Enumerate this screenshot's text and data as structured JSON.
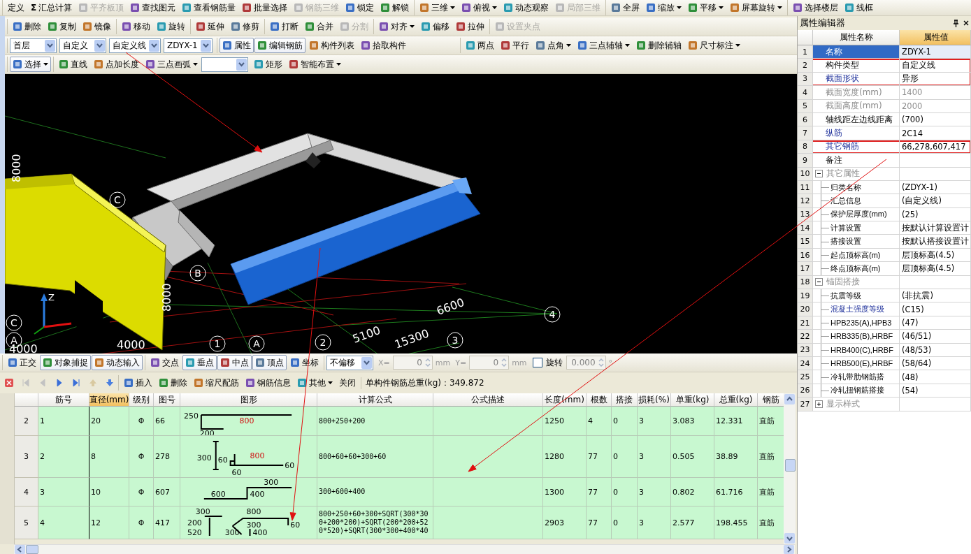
{
  "main_toolbar": {
    "groups": [
      {
        "items": [
          {
            "kind": "button",
            "label": "定义",
            "icon": false,
            "disabled": false,
            "menu": false
          },
          {
            "kind": "button",
            "glyph": "Σ",
            "label": "汇总计算",
            "icon": false,
            "disabled": false,
            "menu": false
          },
          {
            "kind": "button",
            "label": "平齐板顶",
            "icon": true,
            "disabled": true,
            "menu": false
          },
          {
            "kind": "button",
            "label": "查找图元",
            "icon": true,
            "disabled": false,
            "menu": false
          },
          {
            "kind": "button",
            "label": "查看钢筋量",
            "icon": true,
            "disabled": false,
            "menu": false
          },
          {
            "kind": "button",
            "label": "批量选择",
            "icon": true,
            "disabled": false,
            "menu": false
          },
          {
            "kind": "button",
            "label": "钢筋三维",
            "icon": true,
            "disabled": true,
            "menu": false
          },
          {
            "kind": "button",
            "label": "锁定",
            "icon": true,
            "disabled": false,
            "menu": false
          },
          {
            "kind": "button",
            "label": "解锁",
            "icon": true,
            "disabled": false,
            "menu": false
          }
        ]
      },
      {
        "items": [
          {
            "kind": "button",
            "label": "三维",
            "icon": true,
            "disabled": false,
            "menu": true
          },
          {
            "kind": "button",
            "label": "俯视",
            "icon": true,
            "disabled": false,
            "menu": true
          },
          {
            "kind": "button",
            "label": "动态观察",
            "icon": true,
            "disabled": false,
            "menu": false
          },
          {
            "kind": "button",
            "label": "局部三维",
            "icon": true,
            "disabled": true,
            "menu": false
          }
        ]
      },
      {
        "items": [
          {
            "kind": "button",
            "label": "全屏",
            "icon": true,
            "disabled": false,
            "menu": false
          },
          {
            "kind": "button",
            "label": "缩放",
            "icon": true,
            "disabled": false,
            "menu": true
          },
          {
            "kind": "button",
            "label": "平移",
            "icon": true,
            "disabled": false,
            "menu": true
          },
          {
            "kind": "button",
            "label": "屏幕旋转",
            "icon": true,
            "disabled": false,
            "menu": true
          }
        ]
      },
      {
        "items": [
          {
            "kind": "button",
            "label": "选择楼层",
            "icon": true,
            "disabled": false,
            "menu": false
          },
          {
            "kind": "button",
            "label": "线框",
            "icon": true,
            "disabled": false,
            "menu": false
          }
        ]
      }
    ]
  },
  "edit_toolbar": {
    "groups": [
      {
        "items": [
          {
            "kind": "button",
            "label": "删除",
            "icon": true,
            "disabled": false,
            "menu": false
          },
          {
            "kind": "button",
            "label": "复制",
            "icon": true,
            "disabled": false,
            "menu": false
          },
          {
            "kind": "button",
            "label": "镜像",
            "icon": true,
            "disabled": false,
            "menu": false
          }
        ]
      },
      {
        "items": [
          {
            "kind": "button",
            "label": "移动",
            "icon": true,
            "disabled": false,
            "menu": false
          },
          {
            "kind": "button",
            "label": "旋转",
            "icon": true,
            "disabled": false,
            "menu": false
          }
        ]
      },
      {
        "items": [
          {
            "kind": "button",
            "label": "延伸",
            "icon": true,
            "disabled": false,
            "menu": false
          },
          {
            "kind": "button",
            "label": "修剪",
            "icon": true,
            "disabled": false,
            "menu": false
          }
        ]
      },
      {
        "items": [
          {
            "kind": "button",
            "label": "打断",
            "icon": true,
            "disabled": false,
            "menu": false
          },
          {
            "kind": "button",
            "label": "合并",
            "icon": true,
            "disabled": false,
            "menu": false
          },
          {
            "kind": "button",
            "label": "分割",
            "icon": true,
            "disabled": true,
            "menu": false
          }
        ]
      },
      {
        "items": [
          {
            "kind": "button",
            "label": "对齐",
            "icon": true,
            "disabled": false,
            "menu": true
          },
          {
            "kind": "button",
            "label": "偏移",
            "icon": true,
            "disabled": false,
            "menu": false
          },
          {
            "kind": "button",
            "label": "拉伸",
            "icon": true,
            "disabled": false,
            "menu": false
          }
        ]
      },
      {
        "items": [
          {
            "kind": "button",
            "label": "设置夹点",
            "icon": true,
            "disabled": true,
            "menu": false
          }
        ]
      }
    ]
  },
  "component_toolbar": {
    "groups": [
      {
        "items": [
          {
            "kind": "dropdown",
            "value": "首层",
            "disabled": false
          },
          {
            "kind": "dropdown",
            "value": "自定义",
            "disabled": false
          },
          {
            "kind": "dropdown",
            "value": "自定义线",
            "disabled": false
          },
          {
            "kind": "dropdown",
            "value": "ZDYX-1",
            "disabled": false
          }
        ]
      },
      {
        "items": [
          {
            "kind": "button",
            "label": "属性",
            "icon": true,
            "disabled": false,
            "menu": false,
            "pressed": true
          },
          {
            "kind": "button",
            "label": "编辑钢筋",
            "icon": true,
            "disabled": false,
            "menu": false,
            "pressed": true
          },
          {
            "kind": "button",
            "label": "构件列表",
            "icon": true,
            "disabled": false,
            "menu": false,
            "pressed": false
          },
          {
            "kind": "button",
            "label": "拾取构件",
            "icon": true,
            "disabled": false,
            "menu": false,
            "pressed": false
          }
        ]
      },
      {
        "items": [
          {
            "kind": "button",
            "label": "两点",
            "icon": true,
            "disabled": false,
            "menu": false,
            "pressed": false
          },
          {
            "kind": "button",
            "label": "平行",
            "icon": true,
            "disabled": false,
            "menu": false,
            "pressed": false
          },
          {
            "kind": "button",
            "label": "点角",
            "icon": true,
            "disabled": false,
            "menu": true,
            "pressed": false
          },
          {
            "kind": "button",
            "label": "三点辅轴",
            "icon": true,
            "disabled": false,
            "menu": true,
            "pressed": false
          },
          {
            "kind": "button",
            "label": "删除辅轴",
            "icon": true,
            "disabled": false,
            "menu": false,
            "pressed": false
          },
          {
            "kind": "button",
            "label": "尺寸标注",
            "icon": true,
            "disabled": false,
            "menu": true,
            "pressed": false
          }
        ]
      }
    ]
  },
  "draw_toolbar": {
    "groups": [
      {
        "items": [
          {
            "kind": "button",
            "label": "选择",
            "icon": true,
            "disabled": false,
            "menu": true,
            "pressed": true
          }
        ]
      },
      {
        "items": [
          {
            "kind": "button",
            "label": "直线",
            "icon": true,
            "disabled": false,
            "menu": false,
            "pressed": false
          },
          {
            "kind": "button",
            "label": "点加长度",
            "icon": true,
            "disabled": false,
            "menu": false,
            "pressed": false
          },
          {
            "kind": "button",
            "label": "三点画弧",
            "icon": true,
            "disabled": false,
            "menu": true,
            "pressed": false
          },
          {
            "kind": "dropdown",
            "disabled": false
          },
          {
            "kind": "button",
            "label": "矩形",
            "icon": true,
            "disabled": false,
            "menu": false,
            "pressed": false
          },
          {
            "kind": "button",
            "label": "智能布置",
            "icon": true,
            "disabled": false,
            "menu": true,
            "pressed": false
          }
        ]
      }
    ]
  },
  "viewport": {
    "dimension_labels": [
      "8000",
      "8000",
      "4000",
      "4000",
      "5100",
      "6600",
      "15300"
    ],
    "axis_markers": [
      "C",
      "B",
      "4",
      "C",
      "A",
      "1",
      "A",
      "2",
      "3"
    ],
    "gizmo_label": "Z"
  },
  "snap_toolbar": {
    "groups": [
      {
        "items": [
          {
            "kind": "button",
            "label": "正交",
            "icon": true,
            "disabled": false,
            "menu": false,
            "pressed": false
          },
          {
            "kind": "button",
            "label": "对象捕捉",
            "icon": true,
            "disabled": false,
            "menu": false,
            "pressed": true
          },
          {
            "kind": "button",
            "label": "动态输入",
            "icon": true,
            "disabled": false,
            "menu": false,
            "pressed": true
          }
        ]
      },
      {
        "items": [
          {
            "kind": "button",
            "label": "交点",
            "icon": true,
            "disabled": false,
            "menu": false,
            "pressed": false
          },
          {
            "kind": "button",
            "label": "垂点",
            "icon": true,
            "disabled": false,
            "menu": false,
            "pressed": true
          },
          {
            "kind": "button",
            "label": "中点",
            "icon": true,
            "disabled": false,
            "menu": false,
            "pressed": true
          },
          {
            "kind": "button",
            "label": "顶点",
            "icon": true,
            "disabled": false,
            "menu": false,
            "pressed": true
          },
          {
            "kind": "button",
            "label": "坐标",
            "icon": true,
            "disabled": false,
            "menu": false,
            "pressed": false
          }
        ]
      },
      {
        "items": [
          {
            "kind": "dropdown",
            "value": "不偏移",
            "disabled": false
          },
          {
            "kind": "label",
            "text": "X="
          },
          {
            "kind": "spin",
            "value": "0",
            "disabled": true
          },
          {
            "kind": "label",
            "text": "mm"
          },
          {
            "kind": "label",
            "text": "Y="
          },
          {
            "kind": "spin",
            "value": "0",
            "disabled": true
          },
          {
            "kind": "label",
            "text": "mm"
          },
          {
            "kind": "checkbox",
            "label": "旋转",
            "checked": false
          },
          {
            "kind": "spin",
            "value": "0.000",
            "disabled": true
          },
          {
            "kind": "label",
            "text": "°"
          }
        ]
      }
    ]
  },
  "rebar_toolbar": {
    "navigation": [
      {
        "disabled": true
      },
      {
        "disabled": true
      },
      {
        "disabled": false
      },
      {
        "disabled": false
      }
    ],
    "move": [
      {
        "disabled": true
      },
      {
        "disabled": false
      }
    ],
    "groups": [
      {
        "items": [
          {
            "kind": "button",
            "label": "插入",
            "icon": true,
            "disabled": false,
            "menu": false
          },
          {
            "kind": "button",
            "label": "删除",
            "icon": true,
            "disabled": false,
            "menu": false
          },
          {
            "kind": "button",
            "label": "缩尺配筋",
            "icon": true,
            "disabled": false,
            "menu": false
          },
          {
            "kind": "button",
            "label": "钢筋信息",
            "icon": true,
            "disabled": false,
            "menu": false
          },
          {
            "kind": "button",
            "label": "其他",
            "icon": true,
            "disabled": false,
            "menu": true
          },
          {
            "kind": "button",
            "label": "关闭",
            "icon": false,
            "disabled": false,
            "menu": false
          }
        ]
      },
      {
        "items": [
          {
            "kind": "label",
            "text": "单构件钢筋总重(kg)：349.872"
          }
        ]
      }
    ]
  },
  "rebar_table": {
    "columns": [
      {
        "label": "筋号",
        "selected": false
      },
      {
        "label": "直径(mm)",
        "selected": true
      },
      {
        "label": "级别",
        "selected": false
      },
      {
        "label": "图号",
        "selected": false
      },
      {
        "label": "图形",
        "selected": false
      },
      {
        "label": "计算公式",
        "selected": false
      },
      {
        "label": "公式描述",
        "selected": false
      },
      {
        "label": "长度(mm)",
        "selected": false
      },
      {
        "label": "根数",
        "selected": false
      },
      {
        "label": "搭接",
        "selected": false
      },
      {
        "label": "损耗(%)",
        "selected": false
      },
      {
        "label": "单重(kg)",
        "selected": false
      },
      {
        "label": "总重(kg)",
        "selected": false
      },
      {
        "label": "钢筋",
        "selected": false
      }
    ],
    "rows": [
      {
        "row_number": "2",
        "bar_no": "1",
        "diameter": "20",
        "grade": "Φ",
        "figure_no": "66",
        "shape": {
          "kind": "hook",
          "labels": [
            {
              "text": "250",
              "highlight": false
            },
            {
              "text": "800",
              "highlight": true
            },
            {
              "text": "200",
              "highlight": false
            }
          ]
        },
        "formula": "800+250+200",
        "length": "1250",
        "count": "4",
        "lap": "0",
        "loss": "3",
        "unit_weight": "3.083",
        "total_weight": "12.331",
        "rebar": "直筋"
      },
      {
        "row_number": "3",
        "bar_no": "2",
        "diameter": "8",
        "grade": "Φ",
        "figure_no": "278",
        "shape": {
          "kind": "stirrup_hook",
          "labels": [
            {
              "text": "300",
              "highlight": false
            },
            {
              "text": "60",
              "highlight": false
            },
            {
              "text": "800",
              "highlight": true
            },
            {
              "text": "60",
              "highlight": false
            },
            {
              "text": "60",
              "highlight": false
            }
          ]
        },
        "formula": "800+60+60+300+60",
        "length": "1280",
        "count": "77",
        "lap": "0",
        "loss": "3",
        "unit_weight": "0.505",
        "total_weight": "38.89",
        "rebar": "直筋"
      },
      {
        "row_number": "4",
        "bar_no": "3",
        "diameter": "10",
        "grade": "Φ",
        "figure_no": "607",
        "shape": {
          "kind": "step",
          "labels": [
            {
              "text": "300",
              "highlight": false
            },
            {
              "text": "600",
              "highlight": false
            },
            {
              "text": "400",
              "highlight": false
            }
          ]
        },
        "formula": "300+600+400",
        "length": "1300",
        "count": "77",
        "lap": "0",
        "loss": "3",
        "unit_weight": "0.802",
        "total_weight": "61.716",
        "rebar": "直筋"
      },
      {
        "row_number": "5",
        "bar_no": "4",
        "diameter": "12",
        "grade": "Φ",
        "figure_no": "417",
        "shape": {
          "kind": "bent",
          "labels": [
            {
              "text": "300",
              "highlight": false
            },
            {
              "text": "800",
              "highlight": false
            },
            {
              "text": "200",
              "highlight": false
            },
            {
              "text": "300",
              "highlight": false
            },
            {
              "text": "60",
              "highlight": false
            },
            {
              "text": "520",
              "highlight": false
            },
            {
              "text": "300",
              "highlight": false
            },
            {
              "text": "400",
              "highlight": false
            }
          ]
        },
        "formula": "800+250+60+300+SQRT(300*300+200*200)+SQRT(200*200+520*520)+SQRT(300*300+400*40",
        "length": "2903",
        "count": "77",
        "lap": "0",
        "loss": "3",
        "unit_weight": "2.577",
        "total_weight": "198.455",
        "rebar": "直筋"
      }
    ]
  },
  "property_editor": {
    "title": "属性编辑器",
    "columns": [
      "属性名称",
      "属性值"
    ],
    "rows": [
      {
        "number": "1",
        "name": "名称",
        "value": "ZDYX-1",
        "kind": "plain",
        "selected": true,
        "boxed": false
      },
      {
        "number": "2",
        "name": "构件类型",
        "value": "自定义线",
        "kind": "plain",
        "selected": false,
        "boxed": true
      },
      {
        "number": "3",
        "name": "截面形状",
        "value": "异形",
        "kind": "link",
        "selected": false,
        "boxed": true
      },
      {
        "number": "4",
        "name": "截面宽度(mm)",
        "value": "1400",
        "kind": "disabled",
        "selected": false,
        "boxed": false
      },
      {
        "number": "5",
        "name": "截面高度(mm)",
        "value": "2000",
        "kind": "disabled",
        "selected": false,
        "boxed": false
      },
      {
        "number": "6",
        "name": "轴线距左边线距离",
        "value": "(700)",
        "kind": "plain",
        "selected": false,
        "boxed": false
      },
      {
        "number": "7",
        "name": "纵筋",
        "value": "2C14",
        "kind": "link",
        "selected": false,
        "boxed": false
      },
      {
        "number": "8",
        "name": "其它钢筋",
        "value": "66,278,607,417",
        "kind": "link",
        "selected": false,
        "boxed": true
      },
      {
        "number": "9",
        "name": "备注",
        "kind": "plain",
        "selected": false,
        "boxed": false
      },
      {
        "number": "10",
        "name": "其它属性",
        "kind": "group",
        "expanded": true,
        "selected": false,
        "boxed": false,
        "children": [
          {
            "number": "11",
            "name": "归类名称",
            "value": "(ZDYX-1)",
            "kind": "plain",
            "selected": false,
            "boxed": false
          },
          {
            "number": "12",
            "name": "汇总信息",
            "value": "(自定义线)",
            "kind": "plain",
            "selected": false,
            "boxed": false
          },
          {
            "number": "13",
            "name": "保护层厚度(mm)",
            "value": "(25)",
            "kind": "plain",
            "selected": false,
            "boxed": false
          },
          {
            "number": "14",
            "name": "计算设置",
            "value": "按默认计算设置计",
            "kind": "plain",
            "selected": false,
            "boxed": false
          },
          {
            "number": "15",
            "name": "搭接设置",
            "value": "按默认搭接设置计",
            "kind": "plain",
            "selected": false,
            "boxed": false
          },
          {
            "number": "16",
            "name": "起点顶标高(m)",
            "value": "层顶标高(4.5)",
            "kind": "plain",
            "selected": false,
            "boxed": false
          },
          {
            "number": "17",
            "name": "终点顶标高(m)",
            "value": "层顶标高(4.5)",
            "kind": "plain",
            "selected": false,
            "boxed": false
          }
        ]
      },
      {
        "number": "18",
        "name": "锚固搭接",
        "kind": "group",
        "expanded": true,
        "selected": false,
        "boxed": false,
        "children": [
          {
            "number": "19",
            "name": "抗震等级",
            "value": "(非抗震)",
            "kind": "plain",
            "selected": false,
            "boxed": false
          },
          {
            "number": "20",
            "name": "混凝土强度等级",
            "value": "(C15)",
            "kind": "link",
            "selected": false,
            "boxed": false
          },
          {
            "number": "21",
            "name": "HPB235(A),HPB3",
            "value": "(47)",
            "kind": "plain",
            "selected": false,
            "boxed": false
          },
          {
            "number": "22",
            "name": "HRB335(B),HRBF",
            "value": "(46/51)",
            "kind": "plain",
            "selected": false,
            "boxed": false
          },
          {
            "number": "23",
            "name": "HRB400(C),HRBF",
            "value": "(48/53)",
            "kind": "plain",
            "selected": false,
            "boxed": false
          },
          {
            "number": "24",
            "name": "HRB500(E),HRBF",
            "value": "(58/64)",
            "kind": "plain",
            "selected": false,
            "boxed": false
          },
          {
            "number": "25",
            "name": "冷轧带肋钢筋搭",
            "value": "(48)",
            "kind": "plain",
            "selected": false,
            "boxed": false
          },
          {
            "number": "26",
            "name": "冷轧扭钢筋搭接",
            "value": "(54)",
            "kind": "plain",
            "selected": false,
            "boxed": false
          }
        ]
      },
      {
        "number": "27",
        "name": "显示样式",
        "kind": "group",
        "expanded": false,
        "selected": false,
        "boxed": false
      }
    ]
  }
}
